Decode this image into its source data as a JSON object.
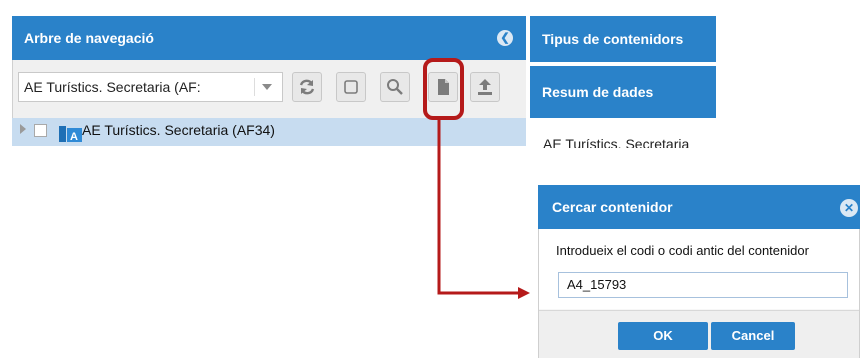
{
  "nav_panel": {
    "title": "Arbre de navegació",
    "combo_value": "AE Turístics. Secretaria (AF:",
    "tree_node_label": "AE Turístics. Secretaria (AF34)"
  },
  "right_panel": {
    "tab_title": "Tipus de contenidors",
    "summary_title": "Resum de dades",
    "summary_text": "AE Turístics. Secretaria"
  },
  "dialog": {
    "title": "Cercar contenidor",
    "label": "Introdueix el codi o codi antic del contenidor",
    "input_value": "A4_15793",
    "ok_label": "OK",
    "cancel_label": "Cancel"
  },
  "colors": {
    "header_blue": "#2a82c9",
    "highlight_red": "#b51a1a",
    "selected_row": "#c7dcf0"
  },
  "icons": [
    "collapse-icon",
    "refresh-icon",
    "select-all-icon",
    "search-icon",
    "document-icon",
    "upload-icon",
    "container-icon",
    "close-icon"
  ]
}
